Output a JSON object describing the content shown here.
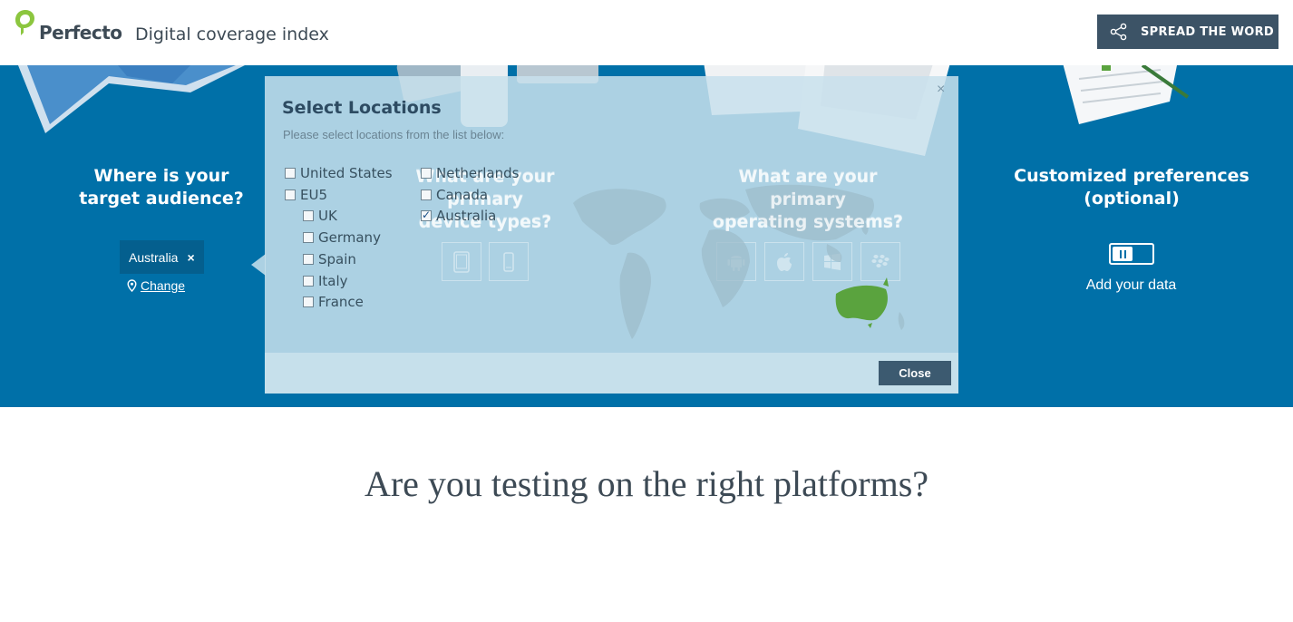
{
  "header": {
    "brand": "Perfecto",
    "subtitle": "Digital coverage index",
    "spread_label": "SPREAD THE WORD"
  },
  "audience": {
    "title_line1": "Where is your",
    "title_line2": "target audience?",
    "selected_tag": "Australia",
    "remove_symbol": "×",
    "change_label": "Change"
  },
  "devices": {
    "title_line1": "What are your primary",
    "title_line2": "device types?",
    "icons": [
      "tablet-icon",
      "phone-icon"
    ]
  },
  "os": {
    "title_line1": "What are your primary",
    "title_line2": "operating systems?",
    "icons": [
      "android-icon",
      "apple-icon",
      "windows-icon",
      "blackberry-icon"
    ]
  },
  "preferences": {
    "title_line1": "Customized preferences",
    "title_line2": "(optional)",
    "add_data_label": "Add your data"
  },
  "modal": {
    "title": "Select Locations",
    "subtitle": "Please select locations from the list below:",
    "close_x": "×",
    "close_label": "Close",
    "locations": [
      {
        "label": "United States",
        "checked": false
      },
      {
        "label": "EU5",
        "checked": false
      },
      {
        "label": "UK",
        "checked": false
      },
      {
        "label": "Germany",
        "checked": false
      },
      {
        "label": "Spain",
        "checked": false
      },
      {
        "label": "Italy",
        "checked": false
      },
      {
        "label": "France",
        "checked": false
      },
      {
        "label": "Netherlands",
        "checked": false
      },
      {
        "label": "Canada",
        "checked": false
      },
      {
        "label": "Australia",
        "checked": true
      }
    ]
  },
  "tagline": "Are you testing on the right platforms?",
  "colors": {
    "band": "#0070a8",
    "button": "#3c5366",
    "australia_highlight": "#5aa33e"
  }
}
